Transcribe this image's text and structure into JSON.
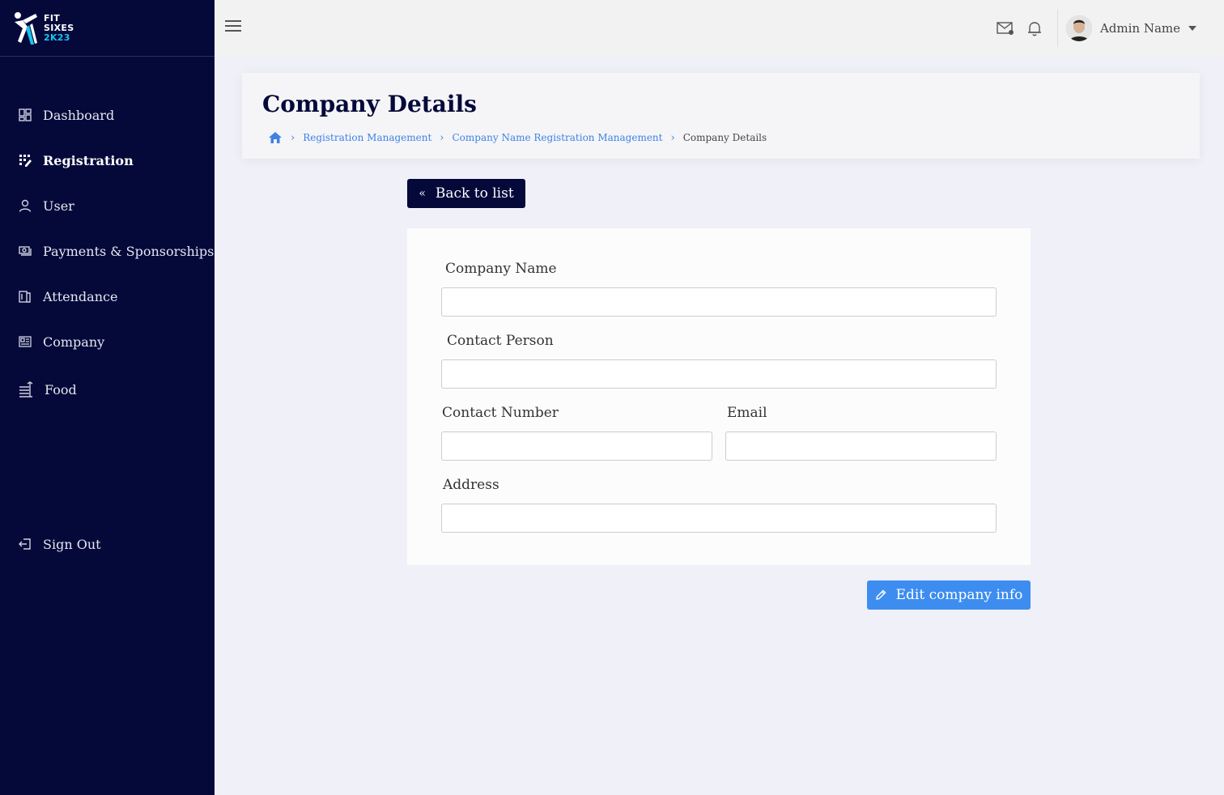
{
  "brand": {
    "line1": "FIT",
    "line2": "SIXES",
    "line3": "2K23",
    "accent_color": "#19c3f0"
  },
  "sidebar": {
    "items": [
      {
        "label": "Dashboard",
        "icon": "dashboard-icon"
      },
      {
        "label": "Registration",
        "icon": "registration-icon",
        "active": true
      },
      {
        "label": "User",
        "icon": "user-icon"
      },
      {
        "label": "Payments & Sponsorships",
        "icon": "payments-icon"
      },
      {
        "label": "Attendance",
        "icon": "attendance-icon"
      },
      {
        "label": "Company",
        "icon": "company-icon"
      },
      {
        "label": "Food",
        "icon": "food-icon"
      }
    ],
    "signout_label": "Sign Out"
  },
  "header": {
    "user_name": "Admin Name"
  },
  "page": {
    "title": "Company Details",
    "breadcrumb": [
      "Registration Management",
      "Company Name Registration Management",
      "Company Details"
    ]
  },
  "actions": {
    "back_label": "Back to list",
    "edit_label": "Edit company info"
  },
  "form": {
    "company_name_label": "Company Name",
    "company_name_value": "",
    "contact_person_label": "Contact Person",
    "contact_person_value": "",
    "contact_number_label": "Contact Number",
    "contact_number_value": "",
    "email_label": "Email",
    "email_value": "",
    "address_label": "Address",
    "address_value": ""
  },
  "colors": {
    "sidebar_bg": "#05093a",
    "primary_button": "#3d8df0",
    "link": "#3d82e6"
  }
}
